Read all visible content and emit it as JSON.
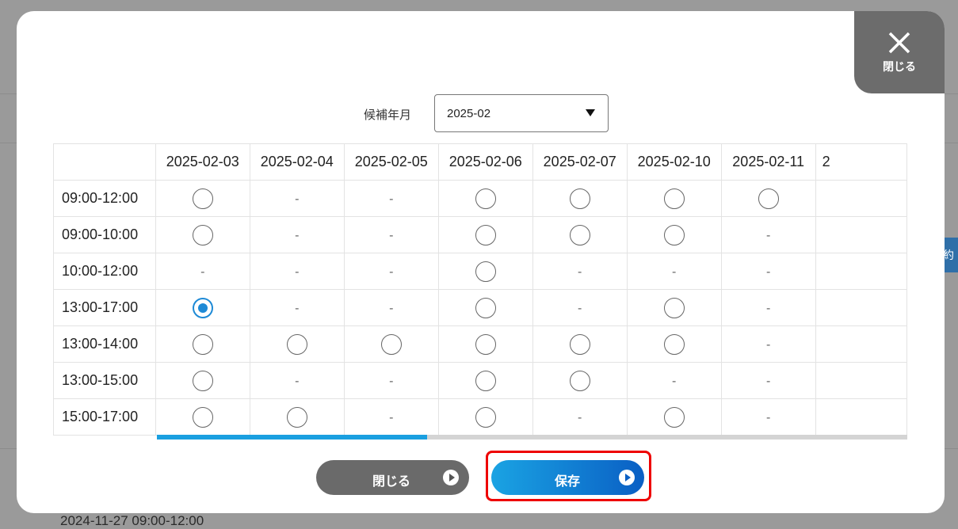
{
  "background": {
    "partial_row_text": "2024-11-27  09:00-12:00",
    "partial_button_text": "約"
  },
  "modal": {
    "close_corner_label": "閉じる",
    "month_label": "候補年月",
    "month_value": "2025-02",
    "dates": [
      "2025-02-03",
      "2025-02-04",
      "2025-02-05",
      "2025-02-06",
      "2025-02-07",
      "2025-02-10",
      "2025-02-11",
      "2"
    ],
    "rows": [
      {
        "time": "09:00-12:00",
        "cells": [
          "o",
          "-",
          "-",
          "o",
          "o",
          "o",
          "o",
          ""
        ]
      },
      {
        "time": "09:00-10:00",
        "cells": [
          "o",
          "-",
          "-",
          "o",
          "o",
          "o",
          "-",
          ""
        ]
      },
      {
        "time": "10:00-12:00",
        "cells": [
          "-",
          "-",
          "-",
          "o",
          "-",
          "-",
          "-",
          ""
        ]
      },
      {
        "time": "13:00-17:00",
        "cells": [
          "sel",
          "-",
          "-",
          "o",
          "-",
          "o",
          "-",
          ""
        ]
      },
      {
        "time": "13:00-14:00",
        "cells": [
          "o",
          "o",
          "o",
          "o",
          "o",
          "o",
          "-",
          ""
        ]
      },
      {
        "time": "13:00-15:00",
        "cells": [
          "o",
          "-",
          "-",
          "o",
          "o",
          "-",
          "-",
          ""
        ]
      },
      {
        "time": "15:00-17:00",
        "cells": [
          "o",
          "o",
          "-",
          "o",
          "-",
          "o",
          "-",
          ""
        ]
      }
    ],
    "scroll_position": 0.36,
    "close_button_label": "閉じる",
    "save_button_label": "保存",
    "accent_color": "#1e8ad6",
    "highlight_color": "#e00000"
  }
}
